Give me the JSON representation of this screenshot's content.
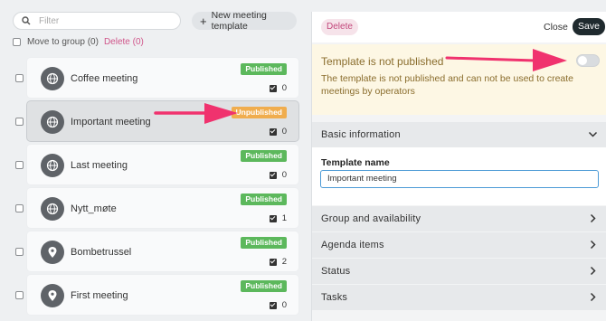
{
  "left": {
    "search": {
      "placeholder": "Filter"
    },
    "new_button": "New meeting template",
    "move_to_group": "Move to group (0)",
    "delete_link": "Delete (0)",
    "items": [
      {
        "name": "Coffee meeting",
        "status": "Published",
        "count": "0",
        "icon": "globe-icon"
      },
      {
        "name": "Important meeting",
        "status": "Unpublished",
        "count": "0",
        "icon": "globe-icon"
      },
      {
        "name": "Last meeting",
        "status": "Published",
        "count": "0",
        "icon": "globe-icon"
      },
      {
        "name": "Nytt_møte",
        "status": "Published",
        "count": "1",
        "icon": "globe-icon"
      },
      {
        "name": "Bombetrussel",
        "status": "Published",
        "count": "2",
        "icon": "location-pin-icon"
      },
      {
        "name": "First meeting",
        "status": "Published",
        "count": "0",
        "icon": "location-pin-icon"
      }
    ]
  },
  "right": {
    "delete_button": "Delete",
    "close_button": "Close",
    "save_button": "Save",
    "notice": {
      "title": "Template is not published",
      "description": "The template is not published and can not be used to create meetings by operators"
    },
    "sections": {
      "basic": "Basic information",
      "group": "Group and availability",
      "agenda": "Agenda items",
      "status": "Status",
      "tasks": "Tasks"
    },
    "template_name_label": "Template name",
    "template_name_value": "Important meeting"
  },
  "colors": {
    "published": "#5cb85c",
    "unpublished": "#f0ad4e",
    "arrow": "#f0326e",
    "delete": "#c2477b"
  }
}
